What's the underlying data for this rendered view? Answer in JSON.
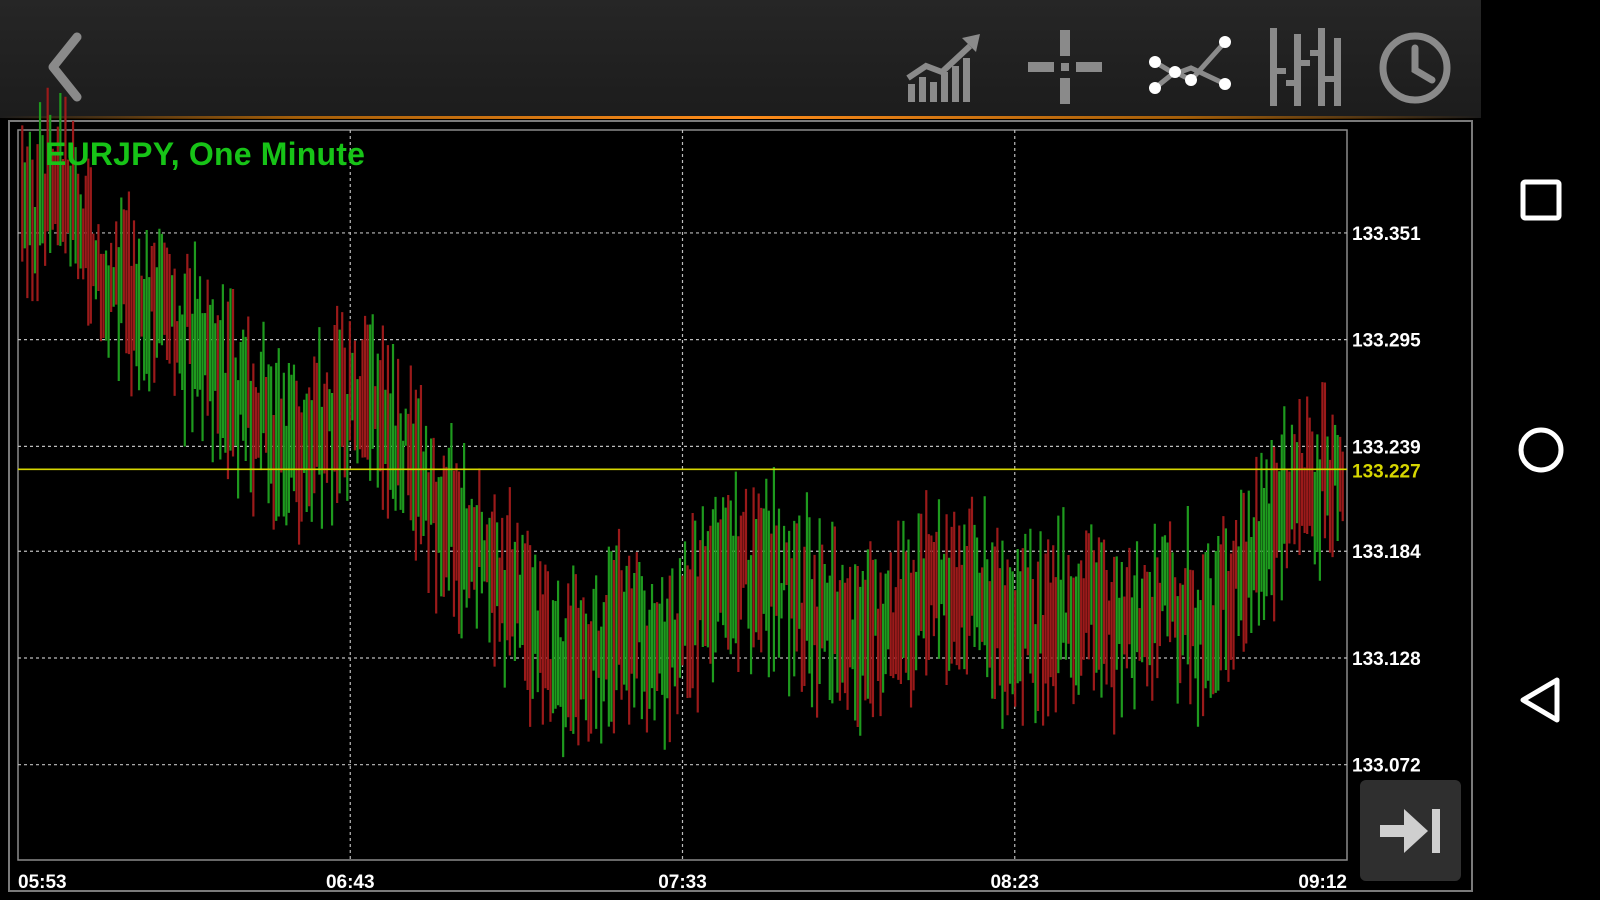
{
  "toolbar": {
    "icons": [
      "back-icon",
      "chart-type-icon",
      "crosshair-icon",
      "indicators-icon",
      "bar-chart-icon",
      "timeframe-clock-icon"
    ]
  },
  "chart": {
    "title": "EURJPY, One Minute",
    "current_price_label": "133.227"
  },
  "chart_data": {
    "type": "ohlc-bars",
    "title": "EURJPY, One Minute",
    "symbol": "EURJPY",
    "timeframe": "One Minute",
    "y_ticks": [
      "133.351",
      "133.295",
      "133.239",
      "133.184",
      "133.128",
      "133.072"
    ],
    "x_ticks": [
      "05:53",
      "06:43",
      "07:33",
      "08:23",
      "09:12"
    ],
    "current_price": 133.227,
    "ylim": [
      133.022,
      133.405
    ],
    "grid": true,
    "up_color": "#1e9a1e",
    "down_color": "#9b1a1a",
    "price_line_color": "#d6d600",
    "trend_points": [
      [
        0,
        133.36
      ],
      [
        15,
        133.38
      ],
      [
        30,
        133.33
      ],
      [
        50,
        133.31
      ],
      [
        70,
        133.29
      ],
      [
        90,
        133.26
      ],
      [
        105,
        133.23
      ],
      [
        120,
        133.25
      ],
      [
        135,
        133.27
      ],
      [
        150,
        133.24
      ],
      [
        165,
        133.2
      ],
      [
        180,
        133.18
      ],
      [
        195,
        133.16
      ],
      [
        210,
        133.12
      ],
      [
        225,
        133.13
      ],
      [
        240,
        133.15
      ],
      [
        255,
        133.13
      ],
      [
        270,
        133.16
      ],
      [
        285,
        133.18
      ],
      [
        300,
        133.17
      ],
      [
        315,
        133.15
      ],
      [
        330,
        133.14
      ],
      [
        345,
        133.15
      ],
      [
        360,
        133.17
      ],
      [
        375,
        133.16
      ],
      [
        390,
        133.14
      ],
      [
        405,
        133.15
      ],
      [
        420,
        133.15
      ],
      [
        435,
        133.14
      ],
      [
        450,
        133.16
      ],
      [
        465,
        133.14
      ],
      [
        480,
        133.17
      ],
      [
        495,
        133.2
      ],
      [
        510,
        133.22
      ],
      [
        520,
        133.23
      ]
    ]
  },
  "nav": {
    "icons": [
      "recents-square-icon",
      "home-circle-icon",
      "back-triangle-icon"
    ]
  },
  "colors": {
    "title": "#17c317",
    "axis_text": "#ffffff",
    "grid": "#bdbdbd",
    "toolbar_bg": "#222222",
    "accent": "#ff8c1a"
  }
}
